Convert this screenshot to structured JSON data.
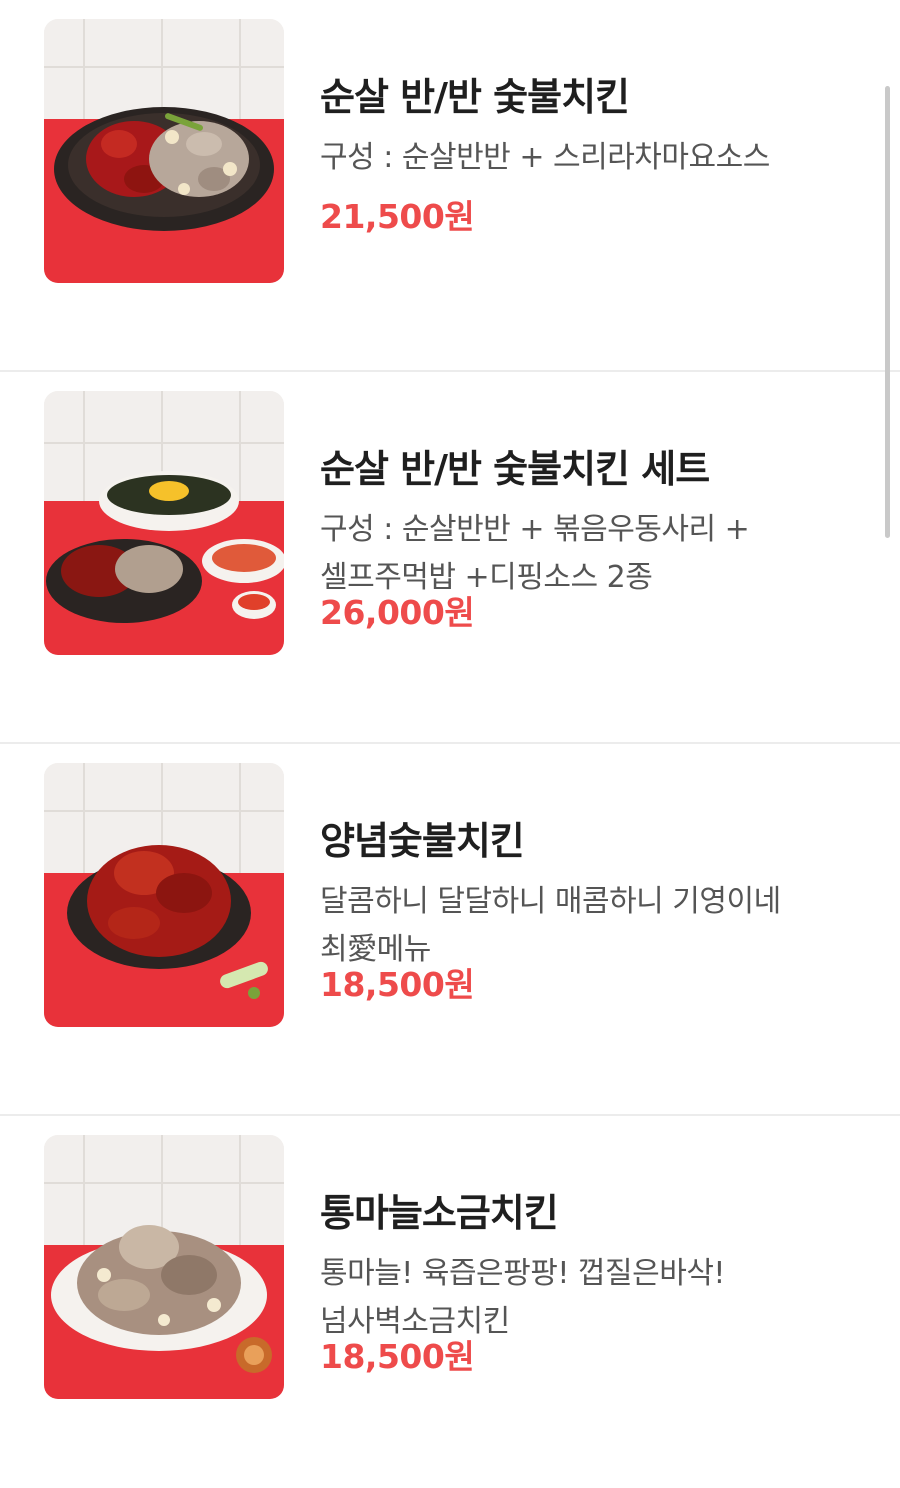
{
  "menu": {
    "items": [
      {
        "name": "순살 반/반 숯불치킨",
        "description": "구성 : 순살반반 + 스리라차마요소스",
        "price": "21,500원"
      },
      {
        "name": "순살 반/반 숯불치킨 세트",
        "description": "구성 : 순살반반 + 볶음우동사리 + 셀프주먹밥 +디핑소스 2종",
        "price": "26,000원"
      },
      {
        "name": "양념숯불치킨",
        "description": "달콤하니 달달하니 매콤하니 기영이네 최愛메뉴",
        "price": "18,500원"
      },
      {
        "name": "통마늘소금치킨",
        "description": "통마늘! 육즙은팡팡! 껍질은바삭! 넘사벽소금치킨",
        "price": "18,500원"
      }
    ]
  },
  "colors": {
    "price": "#ee4b4b",
    "table_red": "#e8323a",
    "divider": "#ececec"
  }
}
